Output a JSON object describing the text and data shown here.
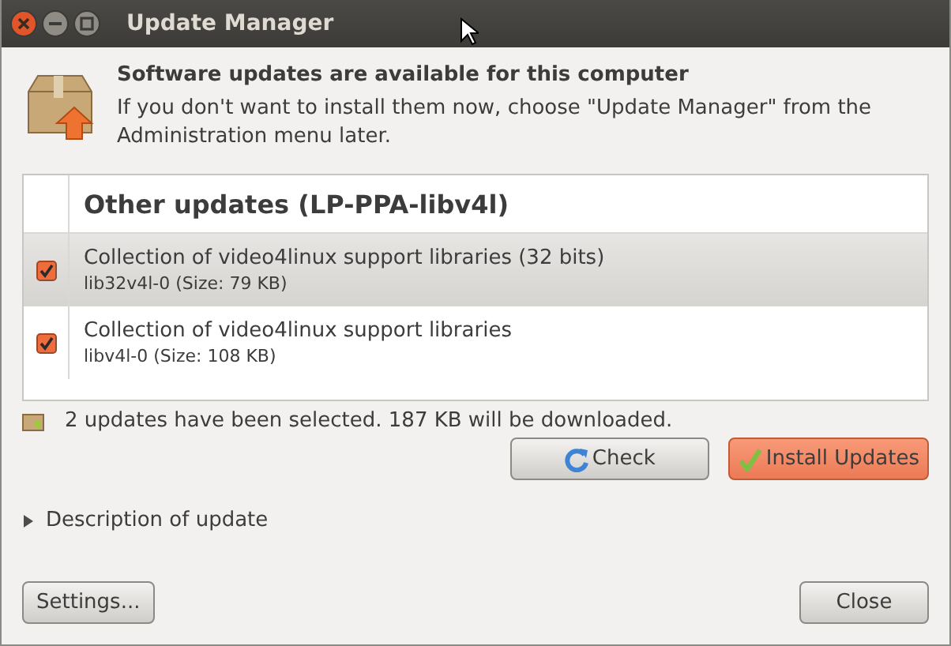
{
  "window": {
    "title": "Update Manager"
  },
  "header": {
    "title": "Software updates are available for this computer",
    "description": "If you don't want to install them now, choose \"Update Manager\" from the Administration menu later."
  },
  "update_list": {
    "group": "Other updates (LP-PPA-libv4l)",
    "rows": [
      {
        "name": "Collection of video4linux support libraries (32 bits)",
        "package": "lib32v4l-0 (Size: 79 KB)",
        "checked": true,
        "selected": true
      },
      {
        "name": "Collection of video4linux support libraries",
        "package": "libv4l-0 (Size: 108 KB)",
        "checked": true,
        "selected": false
      }
    ]
  },
  "status": "2 updates have been selected. 187 KB will be downloaded.",
  "actions": [
    {
      "kind": "check",
      "label": "Check"
    },
    {
      "kind": "install",
      "label": "Install Updates"
    }
  ],
  "expander": {
    "label": "Description of update",
    "expanded": false
  },
  "footer": {
    "settings": "Settings...",
    "close": "Close"
  }
}
